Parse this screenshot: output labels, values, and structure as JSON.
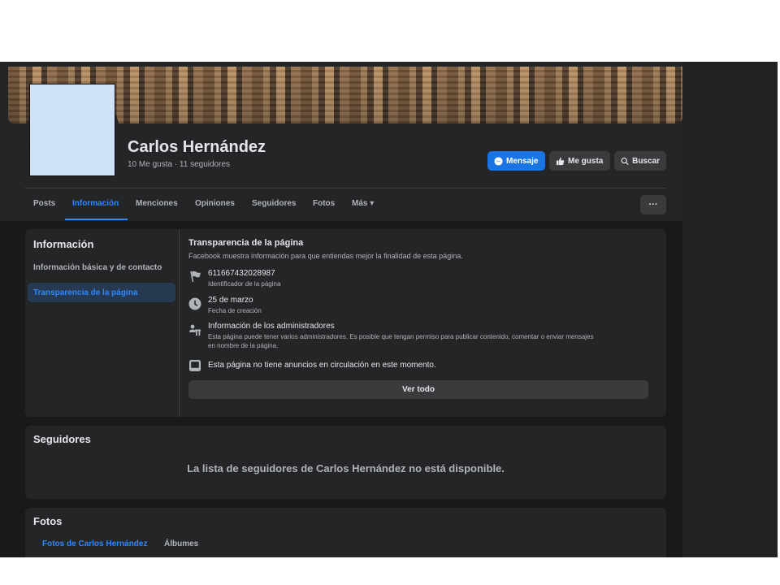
{
  "profile": {
    "name": "Carlos Hernández",
    "stats": "10 Me gusta · 11 seguidores"
  },
  "actions": {
    "message": "Mensaje",
    "like": "Me gusta",
    "search": "Buscar",
    "more": "···"
  },
  "tabs": [
    {
      "label": "Posts"
    },
    {
      "label": "Información"
    },
    {
      "label": "Menciones"
    },
    {
      "label": "Opiniones"
    },
    {
      "label": "Seguidores"
    },
    {
      "label": "Fotos"
    },
    {
      "label": "Más ▾"
    }
  ],
  "active_tab": "Información",
  "about": {
    "title": "Información",
    "sidebar": [
      "Información básica y de contacto",
      "Transparencia de la página"
    ],
    "transparency": {
      "title": "Transparencia de la página",
      "description": "Facebook muestra información para que entiendas mejor la finalidad de esta página.",
      "page_id": "611667432028987",
      "page_id_label": "Identificador de la página",
      "created": "25 de marzo",
      "created_label": "Fecha de creación",
      "admins_title": "Información de los administradores",
      "admins_desc_1": "Esta página puede tener varios administradores. Es posible que tengan permiso para publicar contenido, comentar o enviar mensajes",
      "admins_desc_2": "en nombre de la página.",
      "ads": "Esta página no tiene anuncios en circulación en este momento.",
      "see_all": "Ver todo"
    }
  },
  "followers": {
    "title": "Seguidores",
    "message": "La lista de seguidores de Carlos Hernández no está disponible."
  },
  "photos": {
    "title": "Fotos",
    "tabs": [
      "Fotos de Carlos Hernández",
      "Álbumes"
    ]
  },
  "colors": {
    "accent": "#2d88ff",
    "button_primary": "#1b74e4",
    "card": "#242526",
    "background": "#18191a"
  }
}
